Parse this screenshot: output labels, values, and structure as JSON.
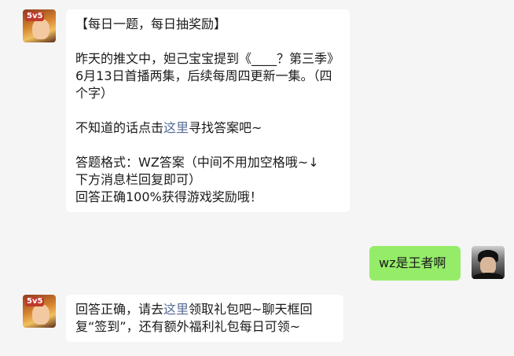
{
  "messages": {
    "msg1": {
      "title": "【每日一题，每日抽奖励】",
      "question": "昨天的推文中，妲己宝宝提到《____？第三季》6月13日首播两集，后续每周四更新一集。（四个字）",
      "hint_pre": "不知道的话点击",
      "hint_link": "这里",
      "hint_post": "寻找答案吧~",
      "format_line1": "答题格式：WZ答案（中间不用加空格哦~↓",
      "format_line2": "下方消息栏回复即可）",
      "reward": "回答正确100%获得游戏奖励哦！"
    },
    "msg2": {
      "text": "wz是王者啊"
    },
    "msg3": {
      "pre": "回答正确，请去",
      "link": "这里",
      "post": "领取礼包吧~聊天框回复“签到”，还有额外福利礼包每日可领~"
    }
  },
  "avatars": {
    "bot_badge": "5v5"
  },
  "colors": {
    "background": "#f5f5f5",
    "bubble_self": "#95ec69",
    "link": "#576b95"
  }
}
